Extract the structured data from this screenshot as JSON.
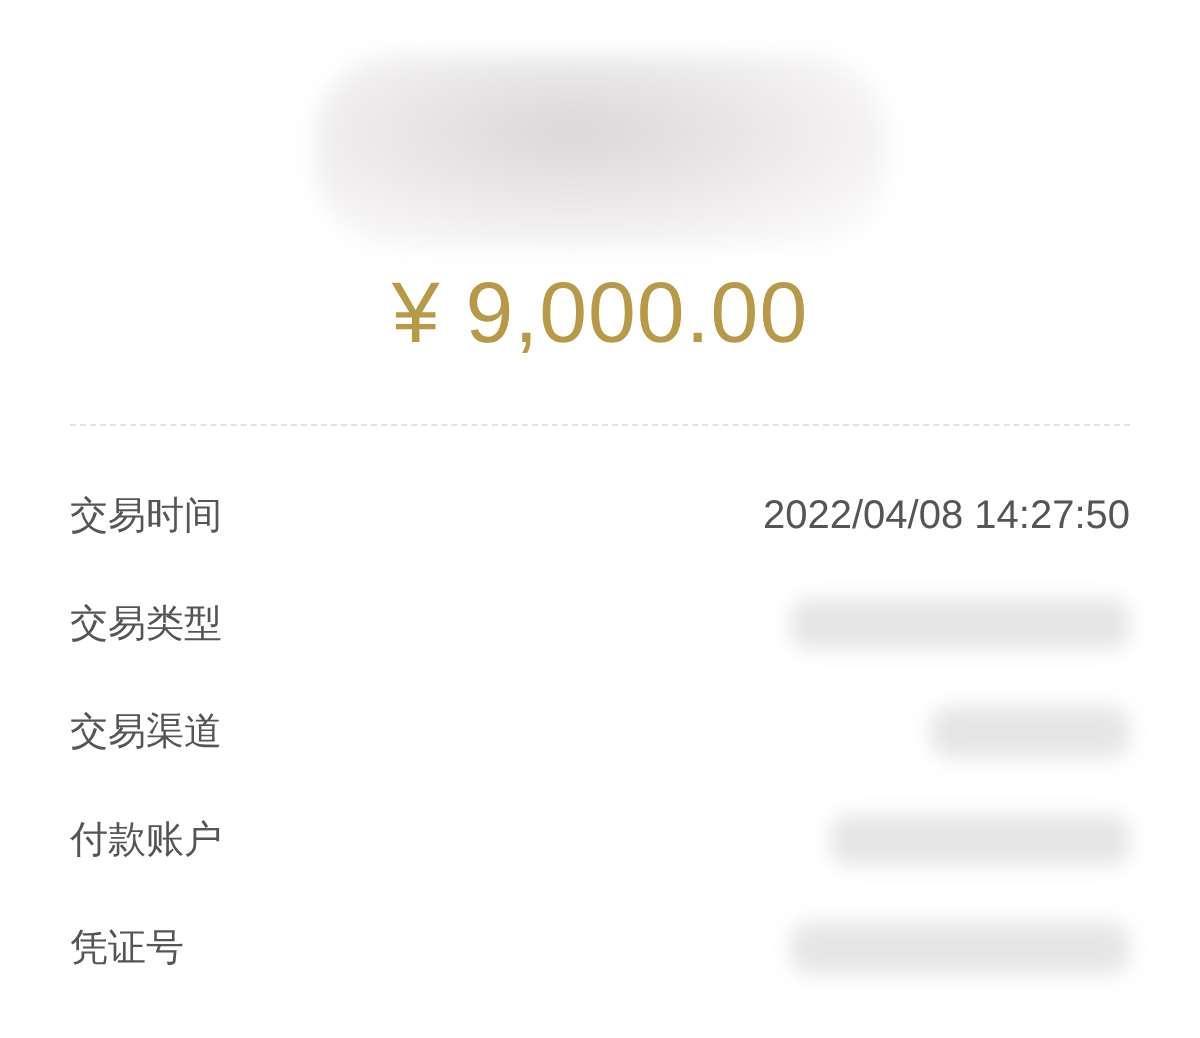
{
  "header": {
    "title": {
      "kind": "redacted"
    },
    "amount": "¥ 9,000.00"
  },
  "details": [
    {
      "label": "交易时间",
      "value": {
        "kind": "text",
        "text": "2022/04/08 14:27:50"
      }
    },
    {
      "label": "交易类型",
      "value": {
        "kind": "redacted"
      }
    },
    {
      "label": "交易渠道",
      "value": {
        "kind": "redacted"
      }
    },
    {
      "label": "付款账户",
      "value": {
        "kind": "redacted"
      }
    },
    {
      "label": "凭证号",
      "value": {
        "kind": "redacted"
      }
    }
  ]
}
